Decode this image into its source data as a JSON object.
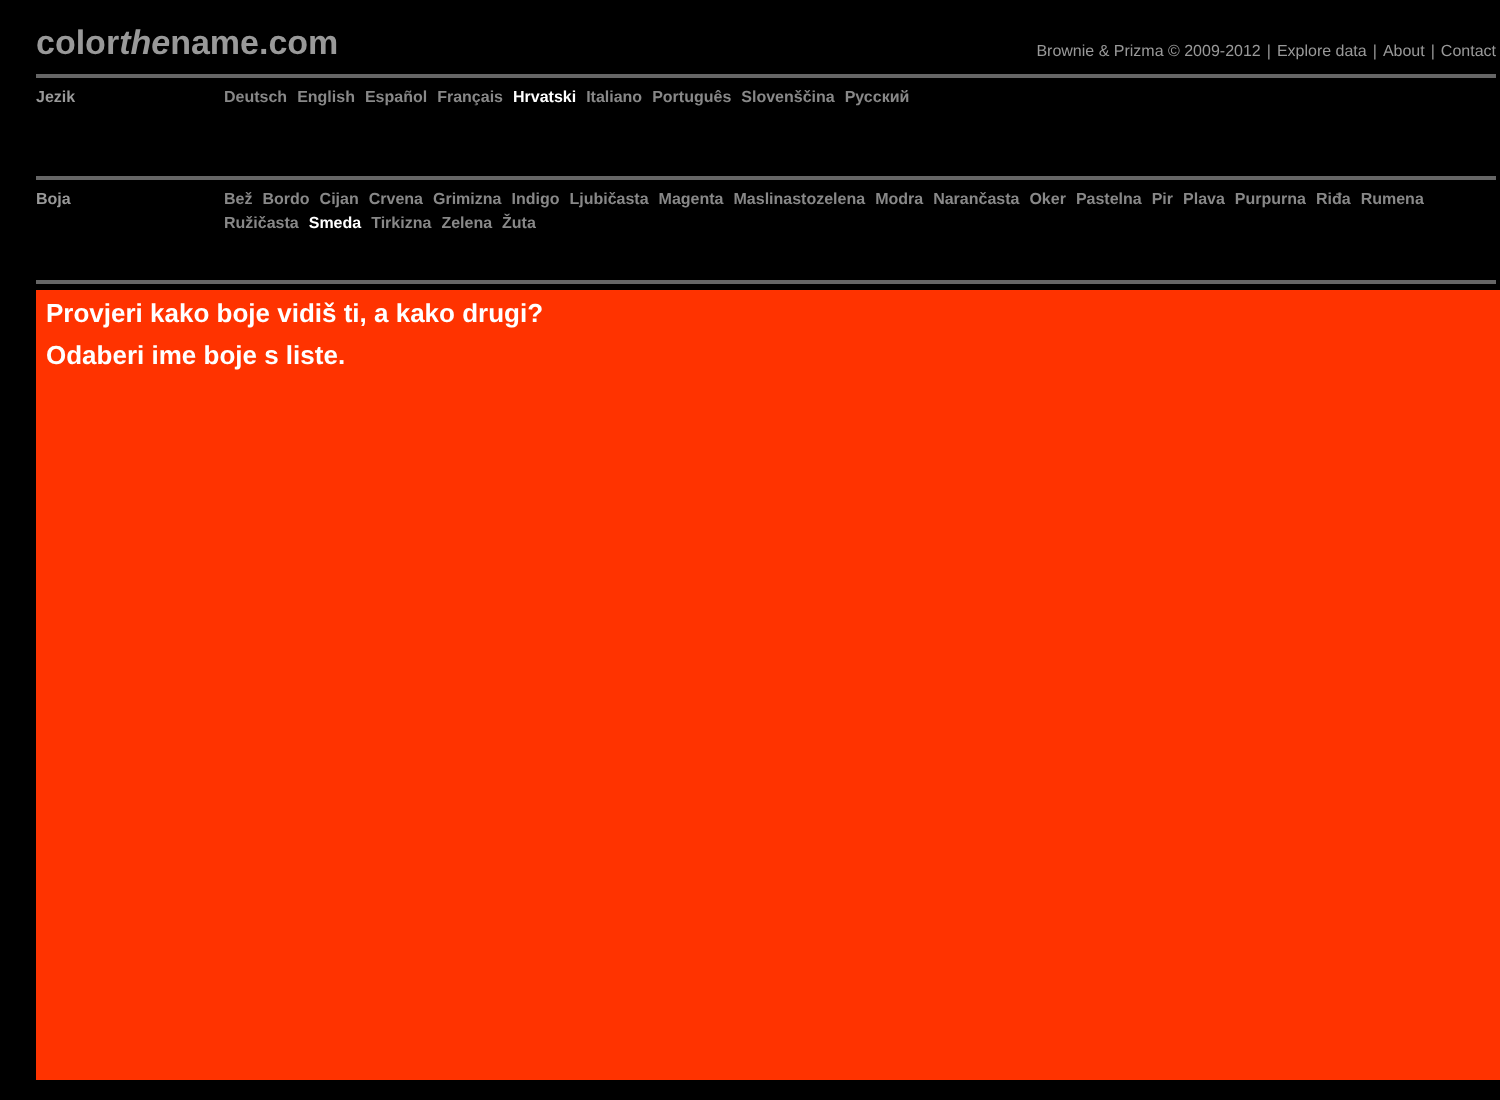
{
  "logo": [
    {
      "text": "color",
      "italic": false
    },
    {
      "text": "the",
      "italic": true
    },
    {
      "text": "name.com",
      "italic": false
    }
  ],
  "top_links": {
    "separator": "|",
    "items": [
      "Brownie & Prizma © 2009-2012",
      "Explore data",
      "About",
      "Contact"
    ]
  },
  "language": {
    "label": "Jezik",
    "items": [
      {
        "label": "Deutsch",
        "selected": false
      },
      {
        "label": "English",
        "selected": false
      },
      {
        "label": "Español",
        "selected": false
      },
      {
        "label": "Français",
        "selected": false
      },
      {
        "label": "Hrvatski",
        "selected": true
      },
      {
        "label": "Italiano",
        "selected": false
      },
      {
        "label": "Português",
        "selected": false
      },
      {
        "label": "Slovenščina",
        "selected": false
      },
      {
        "label": "Русский",
        "selected": false
      }
    ]
  },
  "colors": {
    "label": "Boja",
    "items": [
      {
        "label": "Bež",
        "selected": false
      },
      {
        "label": "Bordo",
        "selected": false
      },
      {
        "label": "Cijan",
        "selected": false
      },
      {
        "label": "Crvena",
        "selected": false
      },
      {
        "label": "Grimizna",
        "selected": false
      },
      {
        "label": "Indigo",
        "selected": false
      },
      {
        "label": "Ljubičasta",
        "selected": false
      },
      {
        "label": "Magenta",
        "selected": false
      },
      {
        "label": "Maslinastozelena",
        "selected": false
      },
      {
        "label": "Modra",
        "selected": false
      },
      {
        "label": "Narančasta",
        "selected": false
      },
      {
        "label": "Oker",
        "selected": false
      },
      {
        "label": "Pastelna",
        "selected": false
      },
      {
        "label": "Pir",
        "selected": false
      },
      {
        "label": "Plava",
        "selected": false
      },
      {
        "label": "Purpurna",
        "selected": false
      },
      {
        "label": "Riđa",
        "selected": false
      },
      {
        "label": "Rumena",
        "selected": false
      },
      {
        "label": "Ružičasta",
        "selected": false
      },
      {
        "label": "Smeda",
        "selected": true
      },
      {
        "label": "Tirkizna",
        "selected": false
      },
      {
        "label": "Zelena",
        "selected": false
      },
      {
        "label": "Žuta",
        "selected": false
      }
    ]
  },
  "panel": {
    "color": "#ff3300",
    "lines": [
      "Provjeri kako boje vidiš ti, a kako drugi?",
      "Odaberi ime boje s liste."
    ]
  }
}
